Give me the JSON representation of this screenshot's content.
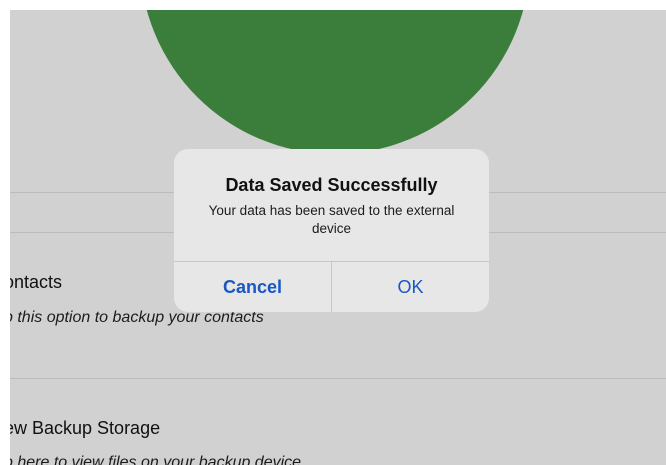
{
  "colors": {
    "hero_circle": "#3b7e3b",
    "background": "#d1d1d1",
    "dialog_background": "#e7e7e7",
    "action_blue": "#1857c4"
  },
  "list": {
    "items": [
      {
        "title": "ontacts",
        "subtitle": "p this option to backup your contacts"
      },
      {
        "title": "ew Backup Storage",
        "subtitle": "p here to view files on your backup device"
      }
    ]
  },
  "dialog": {
    "title": "Data Saved Successfully",
    "message": "Your data has been saved to the external device",
    "cancel_label": "Cancel",
    "ok_label": "OK"
  }
}
